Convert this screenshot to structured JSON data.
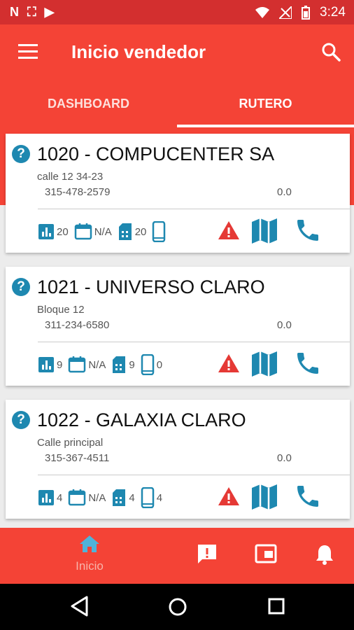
{
  "status_bar": {
    "left_icons": [
      "N",
      "⛶",
      "▶"
    ],
    "time": "3:24"
  },
  "app_bar": {
    "title": "Inicio vendedor"
  },
  "tabs": [
    {
      "label": "DASHBOARD"
    },
    {
      "label": "RUTERO",
      "selected": true
    }
  ],
  "customers": [
    {
      "name": "1020 - COMPUCENTER SA",
      "address": "calle 12 34-23",
      "phone": "315-478-2579",
      "balance": "0.0",
      "stats": {
        "chart": "20",
        "date": "N/A",
        "sim": "20",
        "mobile": ""
      }
    },
    {
      "name": "1021 - UNIVERSO CLARO",
      "address": "Bloque 12",
      "phone": "311-234-6580",
      "balance": "0.0",
      "stats": {
        "chart": "9",
        "date": "N/A",
        "sim": "9",
        "mobile": "0"
      }
    },
    {
      "name": "1022 - GALAXIA CLARO",
      "address": "Calle principal",
      "phone": "315-367-4511",
      "balance": "0.0",
      "stats": {
        "chart": "4",
        "date": "N/A",
        "sim": "4",
        "mobile": "4"
      }
    }
  ],
  "bottom_nav": {
    "home_label": "Inicio"
  },
  "colors": {
    "primary": "#f44336",
    "status_bar": "#d32f2f",
    "accent_teal": "#1e88b0",
    "warning_red": "#e53935"
  }
}
